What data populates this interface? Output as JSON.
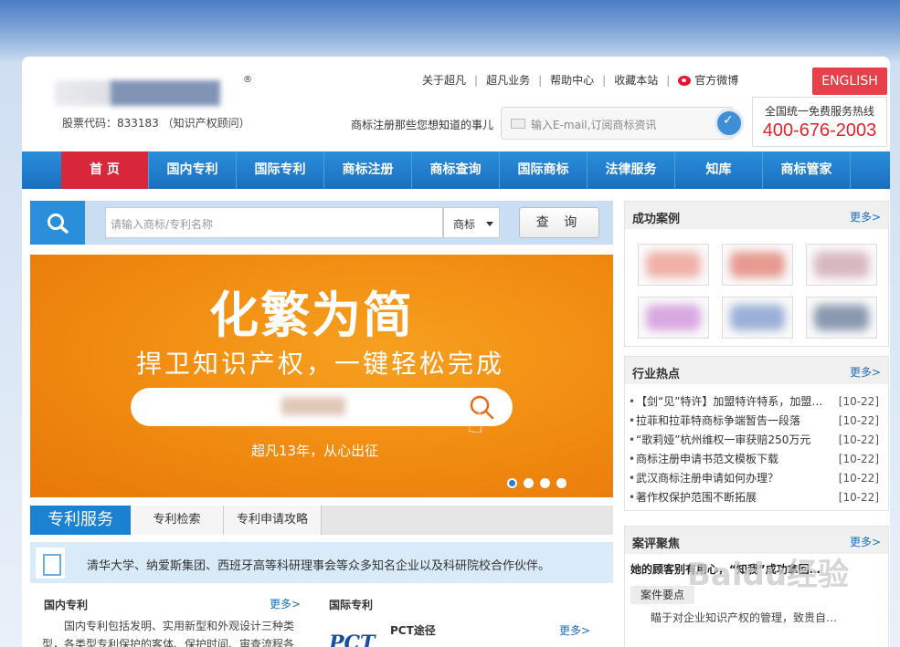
{
  "header": {
    "logo_reg": "®",
    "stock": "股票代码：833183 （知识产权顾问）",
    "links": [
      "关于超凡",
      "超凡业务",
      "帮助中心",
      "收藏本站",
      "官方微博"
    ],
    "english": "ENGLISH",
    "question": "商标注册那些您想知道的事儿",
    "subscribe_placeholder": "输入E-mail,订阅商标资讯",
    "hotline_label": "全国统一免费服务热线",
    "hotline_number": "400-676-2003"
  },
  "nav": [
    "首 页",
    "国内专利",
    "国际专利",
    "商标注册",
    "商标查询",
    "国际商标",
    "法律服务",
    "知库",
    "商标管家"
  ],
  "search": {
    "placeholder": "请输入商标/专利名称",
    "type": "商标",
    "button": "查 询"
  },
  "banner": {
    "title": "化繁为简",
    "subtitle": "捍卫知识产权，一键轻松完成",
    "slogan": "超凡13年，从心出征"
  },
  "patent": {
    "tab_main": "专利服务",
    "tabs": [
      "专利检索",
      "专利申请攻略"
    ],
    "partner": "清华大学、纳爱斯集团、西班牙高等科研理事会等众多知名企业以及科研院校合作伙伴。",
    "domestic_title": "国内专利",
    "domestic_more": "更多>",
    "domestic_text": "国内专利包括发明、实用新型和外观设计三种类型，各类型专利保护的客体、保护时间、审查流程各",
    "intl_title": "国际专利",
    "pct_logo": "PCT",
    "pct_title": "PCT途径",
    "pct_more": "更多>"
  },
  "cases": {
    "title": "成功案例",
    "more": "更多>"
  },
  "hot": {
    "title": "行业热点",
    "more": "更多>",
    "items": [
      {
        "text": "【剑“见”特许】加盟特许特系，加盟…",
        "date": "[10-22]"
      },
      {
        "text": "拉菲和拉菲特商标争端暂告一段落",
        "date": "[10-22]"
      },
      {
        "text": "“歌莉娅”杭州维权一审获赔250万元",
        "date": "[10-22]"
      },
      {
        "text": "商标注册申请书范文模板下载",
        "date": "[10-22]"
      },
      {
        "text": "武汉商标注册申请如何办理？",
        "date": "[10-22]"
      },
      {
        "text": "著作权保护范围不断拓展",
        "date": "[10-22]"
      }
    ]
  },
  "review": {
    "title": "案评聚焦",
    "more": "更多>",
    "headline": "她的顾客别有用心，“知我”成功拿回…",
    "point_label": "案件要点",
    "desc": "瞄于对企业知识产权的管理，致贵自…"
  },
  "watermark": "Baidu经验"
}
